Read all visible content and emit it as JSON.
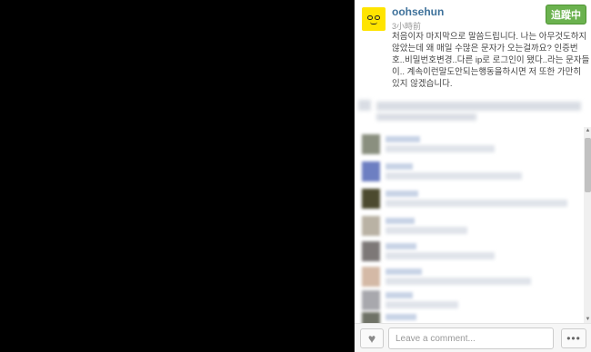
{
  "post": {
    "username": "oohsehun",
    "time": "3小時前",
    "caption": "처음이자 마지막으로 말씀드립니다. 나는 아무것도하지않았는데 왜 매일 수많은 문자가 오는걸까요? 인증번호..비밀번호변경..다른 ip로 로그인이 됐다..라는 문자들이.. 계속이런말도안되는행동을하시면 저 또한 가만히 있지 않겠습니다.",
    "follow_label": "追蹤中"
  },
  "footer": {
    "comment_placeholder": "Leave a comment...",
    "more_label": "•••",
    "like_icon": "heart-icon"
  },
  "colors": {
    "username": "#3f729b",
    "follow_button": "#6bb24f",
    "avatar_bg": "#ffe400"
  }
}
